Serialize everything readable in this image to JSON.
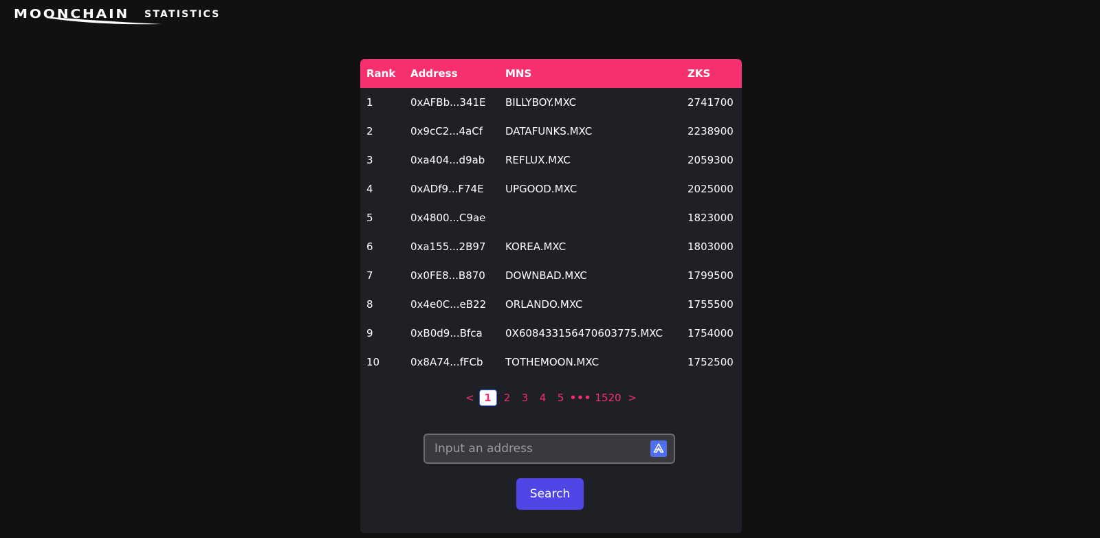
{
  "header": {
    "logo_text": "MOONCHAIN",
    "nav_label": "STATISTICS"
  },
  "table": {
    "columns": [
      "Rank",
      "Address",
      "MNS",
      "ZKS"
    ],
    "rows": [
      [
        "1",
        "0xAFBb...341E",
        "BILLYBOY.MXC",
        "2741700"
      ],
      [
        "2",
        "0x9cC2...4aCf",
        "DATAFUNKS.MXC",
        "2238900"
      ],
      [
        "3",
        "0xa404...d9ab",
        "REFLUX.MXC",
        "2059300"
      ],
      [
        "4",
        "0xADf9...F74E",
        "UPGOOD.MXC",
        "2025000"
      ],
      [
        "5",
        "0x4800...C9ae",
        "",
        "1823000"
      ],
      [
        "6",
        "0xa155...2B97",
        "KOREA.MXC",
        "1803000"
      ],
      [
        "7",
        "0x0FE8...B870",
        "DOWNBAD.MXC",
        "1799500"
      ],
      [
        "8",
        "0x4e0C...eB22",
        "ORLANDO.MXC",
        "1755500"
      ],
      [
        "9",
        "0xB0d9...Bfca",
        "0X608433156470603775.MXC",
        "1754000"
      ],
      [
        "10",
        "0x8A74...fFCb",
        "TOTHEMOON.MXC",
        "1752500"
      ]
    ]
  },
  "pagination": {
    "prev": "<",
    "pages": [
      "1",
      "2",
      "3",
      "4",
      "5"
    ],
    "active": "1",
    "ellipsis": "•••",
    "last": "1520",
    "next": ">"
  },
  "search": {
    "placeholder": "Input an address",
    "value": "",
    "button_label": "Search",
    "field_icon": "autofill-icon"
  },
  "colors": {
    "header_accent": "#f6306f",
    "button": "#4f46e5",
    "card_bg": "#1f2026",
    "page_bg": "#111111"
  }
}
